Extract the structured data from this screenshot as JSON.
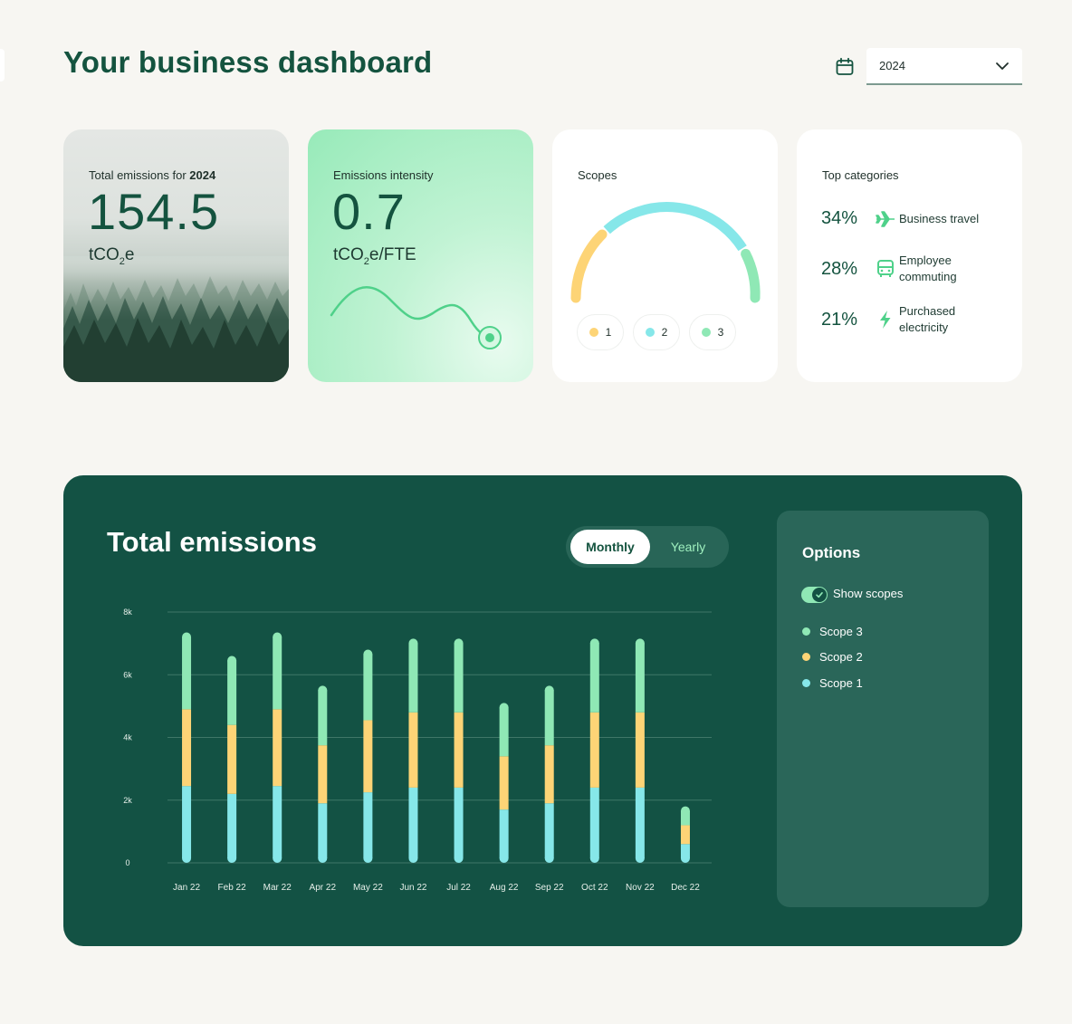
{
  "header": {
    "title": "Your business dashboard",
    "year": "2024"
  },
  "cards": {
    "total": {
      "label_prefix": "Total emissions for ",
      "label_year": "2024",
      "value": "154.5",
      "unit_pre": "tCO",
      "unit_sub": "2",
      "unit_post": "e"
    },
    "intensity": {
      "label": "Emissions intensity",
      "value": "0.7",
      "unit_pre": "tCO",
      "unit_sub": "2",
      "unit_post": "e/FTE"
    },
    "scopes": {
      "label": "Scopes",
      "pills": [
        {
          "label": "1",
          "color": "#fdd476"
        },
        {
          "label": "2",
          "color": "#86e7e9"
        },
        {
          "label": "3",
          "color": "#8fe8b5"
        }
      ]
    },
    "categories": {
      "label": "Top categories",
      "items": [
        {
          "pct": "34%",
          "name": "Business travel",
          "icon": "airplane-icon"
        },
        {
          "pct": "28%",
          "name": "Employee commuting",
          "icon": "bus-icon"
        },
        {
          "pct": "21%",
          "name": "Purchased electricity",
          "icon": "lightning-icon"
        }
      ]
    }
  },
  "emissions": {
    "title": "Total emissions",
    "toggle": {
      "monthly": "Monthly",
      "yearly": "Yearly",
      "selected": "Monthly"
    },
    "options": {
      "title": "Options",
      "show_scopes_label": "Show scopes",
      "show_scopes_on": true,
      "legend": [
        {
          "label": "Scope 3",
          "color": "#8fe8b5"
        },
        {
          "label": "Scope 2",
          "color": "#fdd476"
        },
        {
          "label": "Scope 1",
          "color": "#86e7e9"
        }
      ]
    }
  },
  "colors": {
    "brand": "#14533f",
    "scope1": "#86e7e9",
    "scope2": "#fdd476",
    "scope3": "#8fe8b5"
  },
  "chart_data": {
    "type": "bar",
    "stacked": true,
    "categories": [
      "Jan 22",
      "Feb 22",
      "Mar 22",
      "Apr 22",
      "May 22",
      "Jun 22",
      "Jul 22",
      "Aug 22",
      "Sep 22",
      "Oct 22",
      "Nov 22",
      "Dec 22"
    ],
    "series": [
      {
        "name": "Scope 1",
        "color": "#86e7e9",
        "values": [
          2450,
          2200,
          2450,
          1900,
          2250,
          2400,
          2400,
          1700,
          1900,
          2400,
          2400,
          600
        ]
      },
      {
        "name": "Scope 2",
        "color": "#fdd476",
        "values": [
          2450,
          2200,
          2450,
          1850,
          2300,
          2400,
          2400,
          1700,
          1850,
          2400,
          2400,
          600
        ]
      },
      {
        "name": "Scope 3",
        "color": "#8fe8b5",
        "values": [
          2450,
          2200,
          2450,
          1900,
          2250,
          2350,
          2350,
          1700,
          1900,
          2350,
          2350,
          600
        ]
      }
    ],
    "y_ticks": [
      "0",
      "2k",
      "4k",
      "6k",
      "8k"
    ],
    "ylim": [
      0,
      8000
    ],
    "grid": true,
    "legend": "right"
  }
}
